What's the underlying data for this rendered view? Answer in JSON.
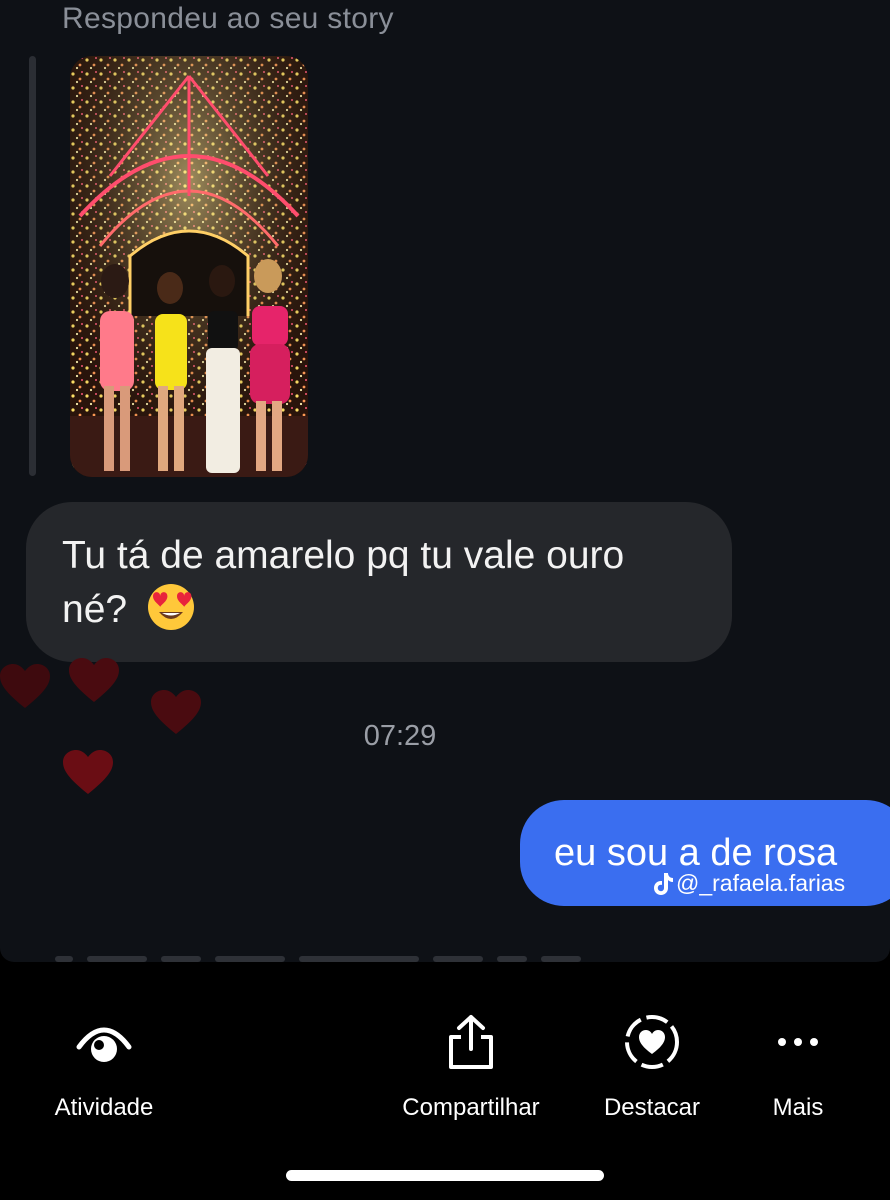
{
  "thread": {
    "reply_header": "Respondeu ao seu story",
    "received_message": "Tu tá de amarelo pq tu vale ouro né?",
    "received_emoji": "smiling-face-with-heart-eyes-icon",
    "timestamp": "07:29",
    "sent_message": "eu sou a de rosa",
    "watermark": "@_rafaela.farias",
    "watermark_icon": "tiktok-icon"
  },
  "actions": [
    {
      "label": "Atividade",
      "icon": "eye-activity-icon"
    },
    {
      "label": "Compartilhar",
      "icon": "share-icon"
    },
    {
      "label": "Destacar",
      "icon": "highlight-heart-icon"
    },
    {
      "label": "Mais",
      "icon": "more-dots-icon"
    }
  ],
  "colors": {
    "chat_background": "#0e1116",
    "received_bubble": "#25272b",
    "sent_bubble": "#3a6ef0",
    "hearts": "#5e0c12"
  }
}
